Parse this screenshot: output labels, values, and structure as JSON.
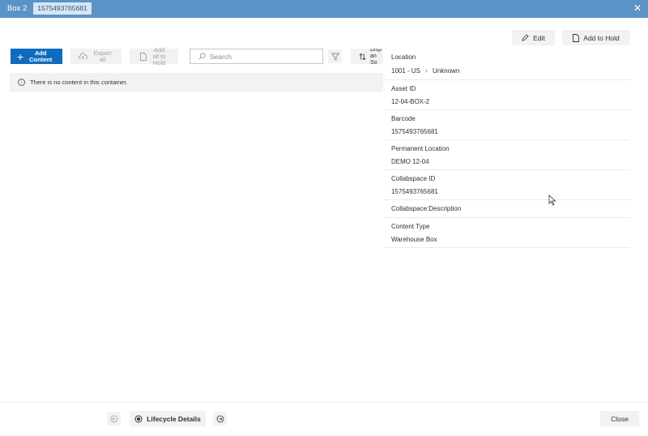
{
  "window": {
    "title": "Box 2",
    "id_chip": "1575493765681",
    "close_icon": "close-icon"
  },
  "toolbar": {
    "add_content_label": "Add Content",
    "export_all_label": "Export all",
    "add_all_to_hold_label": "Add all to Hold",
    "search_placeholder": "Search",
    "sort_label": "Disp an So"
  },
  "info_message": "There is no content in this container.",
  "actions": {
    "edit_label": "Edit",
    "add_to_hold_label": "Add to Hold"
  },
  "properties": [
    {
      "label": "Location",
      "value": "1001 - US",
      "value_extra": "Unknown"
    },
    {
      "label": "Asset ID",
      "value": "12-04-BOX-2"
    },
    {
      "label": "Barcode",
      "value": "1575493765681"
    },
    {
      "label": "Permanent Location",
      "value": "DEMO 12-04"
    },
    {
      "label": "Collabspace ID",
      "value": "1575493765681"
    },
    {
      "label": "Collabspace:Description",
      "value": ""
    },
    {
      "label": "Content Type",
      "value": "Warehouse Box"
    }
  ],
  "footer": {
    "lifecycle_label": "Lifecycle Details",
    "close_label": "Close"
  },
  "colors": {
    "titlebar": "#5b93c6",
    "primary": "#0f6cbd",
    "neutral_button": "#f3f2f1"
  }
}
